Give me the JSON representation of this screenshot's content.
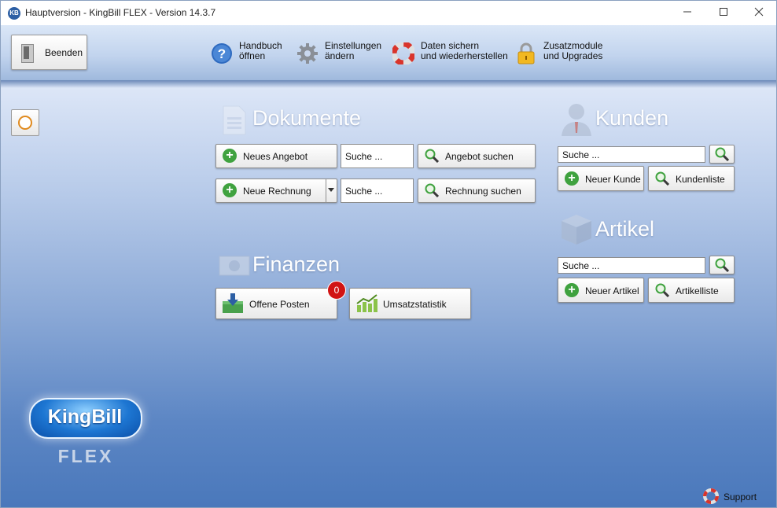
{
  "window": {
    "icon_text": "KB",
    "title": "Hauptversion - KingBill FLEX - Version 14.3.7",
    "controls": [
      "minimize",
      "maximize",
      "close"
    ]
  },
  "toolbar": {
    "exit_label": "Beenden",
    "items": [
      {
        "label": "Handbuch\nöffnen",
        "icon": "help-icon"
      },
      {
        "label": "Einstellungen\nändern",
        "icon": "gear-icon"
      },
      {
        "label": "Daten sichern\nund wiederherstellen",
        "icon": "lifebuoy-icon"
      },
      {
        "label": "Zusatzmodule\nund Upgrades",
        "icon": "lock-icon"
      }
    ]
  },
  "dokumente": {
    "title": "Dokumente",
    "new_offer": "Neues Angebot",
    "new_invoice": "Neue Rechnung",
    "search_placeholder": "Suche ...",
    "search_offer": "Angebot suchen",
    "search_invoice": "Rechnung suchen"
  },
  "finanzen": {
    "title": "Finanzen",
    "open_items": "Offene Posten",
    "open_items_count": "0",
    "sales_stats": "Umsatzstatistik"
  },
  "kunden": {
    "title": "Kunden",
    "search_placeholder": "Suche ...",
    "new_customer": "Neuer Kunde",
    "customer_list": "Kundenliste"
  },
  "artikel": {
    "title": "Artikel",
    "search_placeholder": "Suche ...",
    "new_article": "Neuer Artikel",
    "article_list": "Artikelliste"
  },
  "logo": {
    "brand": "KingBill",
    "edition": "FLEX"
  },
  "support": {
    "label": "Support"
  },
  "colors": {
    "accent_green": "#3fa23f",
    "badge_red": "#d11414",
    "background_blue": "#4a78bb"
  }
}
